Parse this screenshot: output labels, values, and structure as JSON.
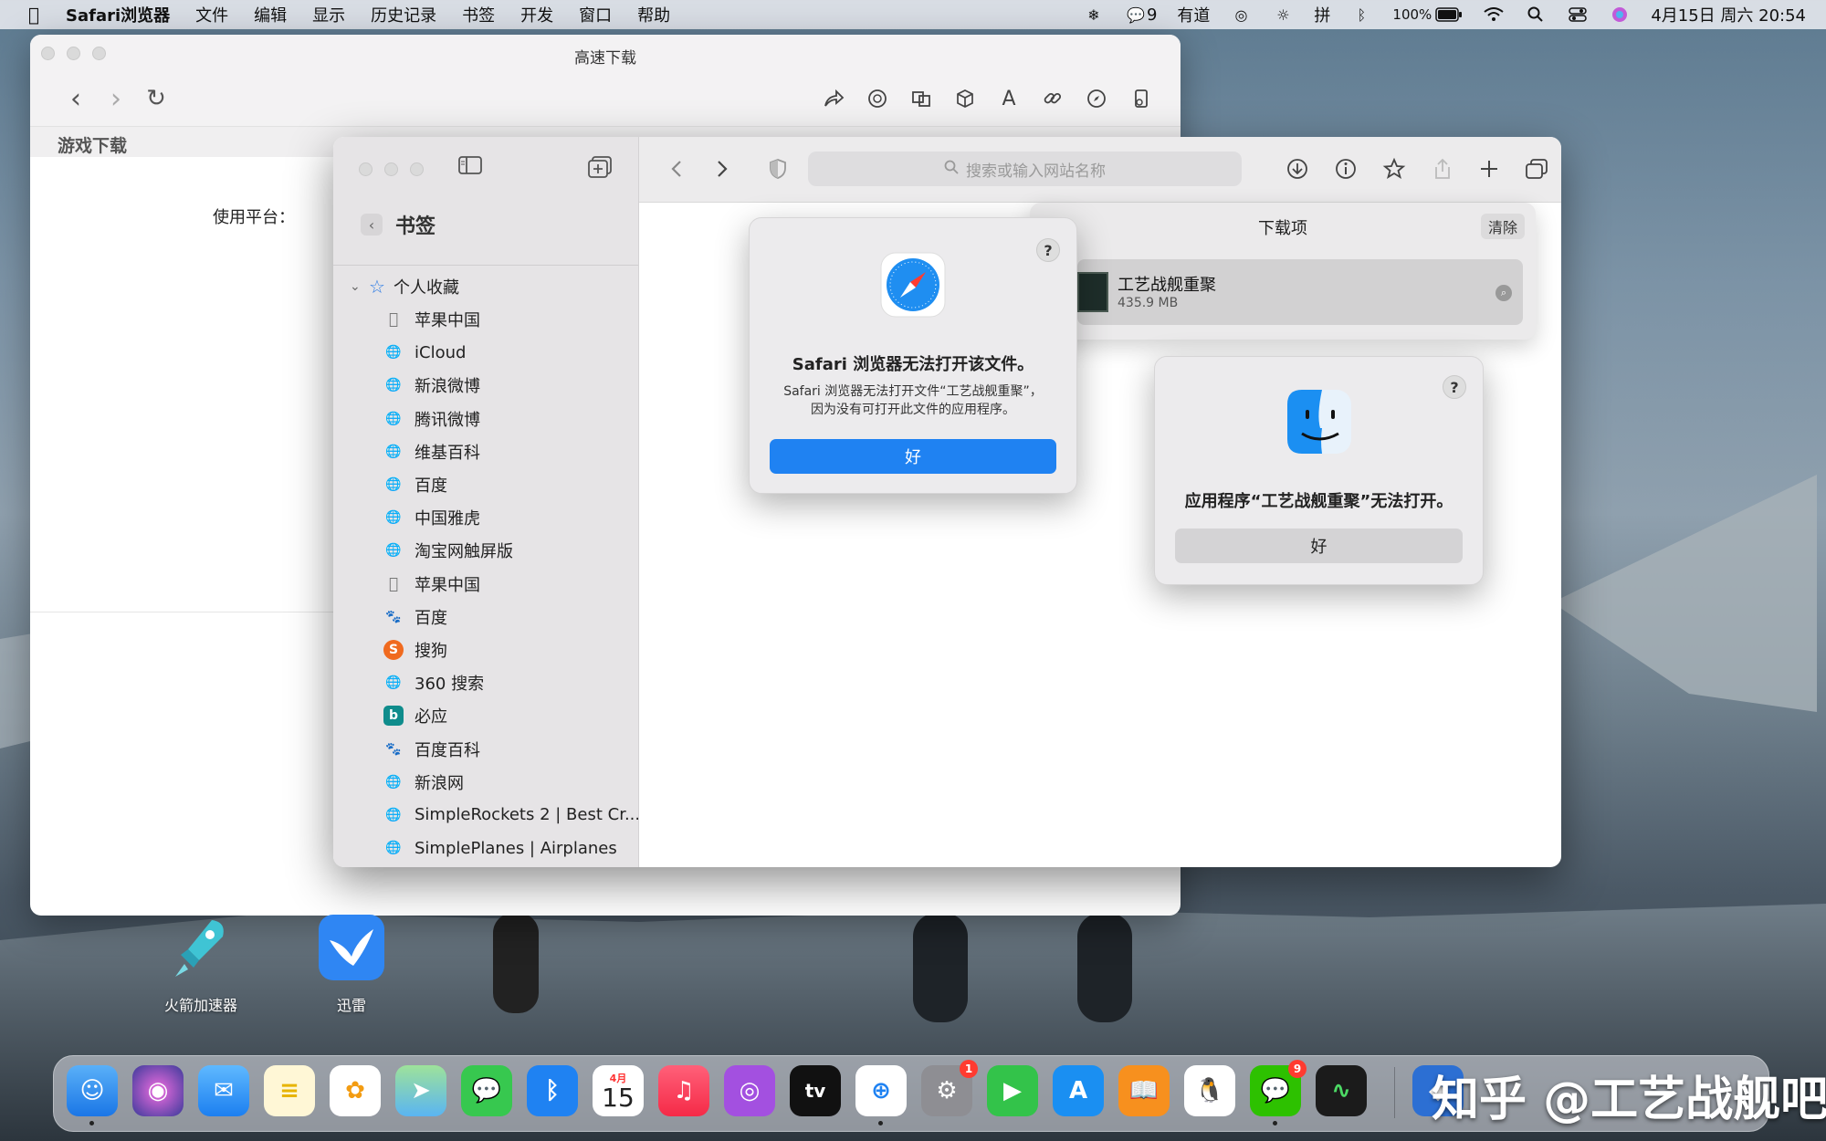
{
  "menubar": {
    "app_name": "Safari浏览器",
    "menus": [
      "文件",
      "编辑",
      "显示",
      "历史记录",
      "书签",
      "开发",
      "窗口",
      "帮助"
    ],
    "wechat_count": "9",
    "youdao": "有道",
    "input_method": "拼",
    "battery": "100%",
    "datetime": "4月15日 周六  20:54"
  },
  "back_window": {
    "title": "高速下载",
    "tab_label": "游戏下载",
    "platform_label": "使用平台："
  },
  "safari": {
    "sidebar": {
      "header": "书签",
      "folder": "个人收藏",
      "items": [
        {
          "label": "苹果中国",
          "icon": "apple-icon"
        },
        {
          "label": "iCloud",
          "icon": "globe-icon"
        },
        {
          "label": "新浪微博",
          "icon": "globe-icon"
        },
        {
          "label": "腾讯微博",
          "icon": "globe-icon"
        },
        {
          "label": "维基百科",
          "icon": "globe-icon"
        },
        {
          "label": "百度",
          "icon": "globe-icon"
        },
        {
          "label": "中国雅虎",
          "icon": "globe-icon"
        },
        {
          "label": "淘宝网触屏版",
          "icon": "globe-icon"
        },
        {
          "label": "苹果中国",
          "icon": "apple-icon"
        },
        {
          "label": "百度",
          "icon": "baidu-icon"
        },
        {
          "label": "搜狗",
          "icon": "sogou-icon"
        },
        {
          "label": "360 搜索",
          "icon": "globe-icon"
        },
        {
          "label": "必应",
          "icon": "bing-icon"
        },
        {
          "label": "百度百科",
          "icon": "baidu-icon"
        },
        {
          "label": "新浪网",
          "icon": "globe-icon"
        },
        {
          "label": "SimpleRockets 2 | Best Cr...",
          "icon": "globe-icon"
        },
        {
          "label": "SimplePlanes | Airplanes",
          "icon": "globe-icon"
        }
      ]
    },
    "address_placeholder": "搜索或输入网站名称"
  },
  "downloads": {
    "title": "下载项",
    "clear_label": "清除",
    "item_name": "工艺战舰重聚",
    "item_size": "435.9 MB"
  },
  "dialog_safari": {
    "help": "?",
    "heading": "Safari 浏览器无法打开该文件。",
    "message": "Safari 浏览器无法打开文件“工艺战舰重聚”，因为没有可打开此文件的应用程序。",
    "ok_label": "好"
  },
  "dialog_finder": {
    "help": "?",
    "heading": "应用程序“工艺战舰重聚”无法打开。",
    "ok_label": "好"
  },
  "desktop_icons": [
    {
      "label": "火箭加速器"
    },
    {
      "label": "迅雷"
    }
  ],
  "dock": {
    "calendar_month": "4月",
    "calendar_day": "15",
    "settings_badge": "1",
    "wechat_badge": "9",
    "tv_label": "tv"
  },
  "watermark": "知乎 @工艺战舰吧",
  "colors": {
    "accent_blue": "#1f82f2",
    "badge_red": "#ff3b30"
  }
}
